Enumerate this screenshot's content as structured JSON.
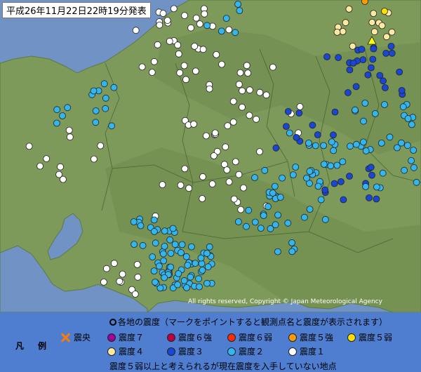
{
  "header": {
    "title": "平成26年11月22日22時19分発表"
  },
  "map": {
    "copyright": "All rights reserved, Copyright © Japan Meteorological Agency"
  },
  "colors": {
    "land": "#7d9a5a",
    "water": "#7092c4",
    "int1": "#ffffff",
    "int2": "#33b5f0",
    "int3": "#1a46d6",
    "int4": "#ffe9a3",
    "int5lower": "#ffe000",
    "int5upper": "#ff9c00",
    "int6lower": "#ff2a00",
    "int6upper": "#c0003c",
    "int7": "#a0009a",
    "epicenter": "#ff7a00",
    "unknown_triangle": "#ffff00"
  },
  "legend": {
    "heading": "各地の震度（マークをポイントすると観測点名と震度が表示されます）",
    "side_label": "凡例",
    "epicenter": "震央",
    "int7": "震度７",
    "int6upper": "震度６強",
    "int6lower": "震度６弱",
    "int5upper": "震度５強",
    "int5lower": "震度５弱",
    "int4": "震度４",
    "int3": "震度３",
    "int2": "震度２",
    "int1": "震度１",
    "footnote": "震度５弱以上と考えられるが現在震度を入手していない地点"
  }
}
